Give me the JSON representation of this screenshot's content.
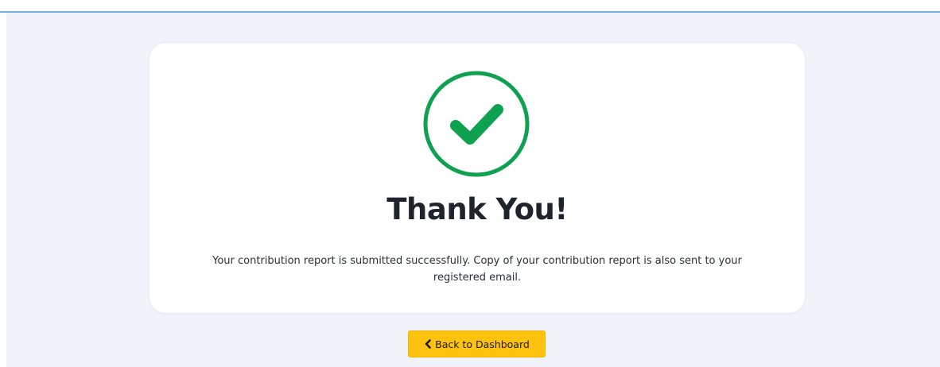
{
  "topbar": {
    "breadcrumb": "·  ·  ·  ·  ·  ·  ·  ·  ·  ·  ·  ·  ·  ·  ·"
  },
  "confirmation": {
    "icon": "check-circle-icon",
    "title": "Thank You!",
    "message": "Your contribution report is submitted successfully. Copy of your contribution report is also sent to your registered email."
  },
  "actions": {
    "back_label": "Back to Dashboard",
    "back_icon": "chevron-left-icon"
  },
  "colors": {
    "success": "#0ea14f",
    "button": "#fdc20d",
    "accent_rule": "#73b3dd",
    "page_bg": "#f0f3fa"
  }
}
